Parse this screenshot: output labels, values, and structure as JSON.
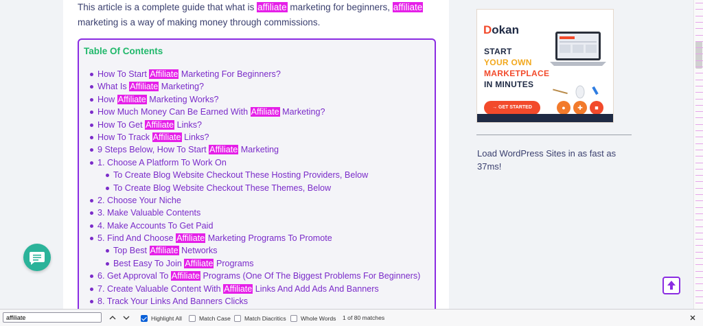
{
  "article": {
    "intro": [
      {
        "t": "This article is a complete guide that what is "
      },
      {
        "t": "affiliate",
        "hl": true
      },
      {
        "t": " marketing for beginners, "
      },
      {
        "t": "affiliate",
        "hl": true
      },
      {
        "t": " marketing is a way of making money through commissions."
      }
    ]
  },
  "toc": {
    "title": "Table Of Contents",
    "items": [
      {
        "level": 1,
        "parts": [
          {
            "t": "How To Start "
          },
          {
            "t": "Affiliate",
            "hl": true
          },
          {
            "t": " Marketing For Beginners?"
          }
        ]
      },
      {
        "level": 1,
        "parts": [
          {
            "t": "What Is "
          },
          {
            "t": "Affiliate",
            "hl": true
          },
          {
            "t": " Marketing?"
          }
        ]
      },
      {
        "level": 1,
        "parts": [
          {
            "t": "How "
          },
          {
            "t": "Affiliate",
            "hl": true
          },
          {
            "t": " Marketing Works?"
          }
        ]
      },
      {
        "level": 1,
        "parts": [
          {
            "t": "How Much Money Can Be Earned With "
          },
          {
            "t": "Affiliate",
            "hl": true
          },
          {
            "t": " Marketing?"
          }
        ]
      },
      {
        "level": 1,
        "parts": [
          {
            "t": "How To Get "
          },
          {
            "t": "Affiliate",
            "hl": true
          },
          {
            "t": " Links?"
          }
        ]
      },
      {
        "level": 1,
        "parts": [
          {
            "t": "How To Track "
          },
          {
            "t": "Affiliate",
            "hl": true
          },
          {
            "t": " Links?"
          }
        ]
      },
      {
        "level": 1,
        "parts": [
          {
            "t": "9 Steps Below, How To Start "
          },
          {
            "t": "Affiliate",
            "hl": true
          },
          {
            "t": " Marketing"
          }
        ]
      },
      {
        "level": 1,
        "parts": [
          {
            "t": "1. Choose A Platform To Work On"
          }
        ]
      },
      {
        "level": 2,
        "parts": [
          {
            "t": "To Create Blog Website Checkout These Hosting Providers, Below"
          }
        ]
      },
      {
        "level": 2,
        "parts": [
          {
            "t": "To Create Blog Website Checkout These Themes, Below"
          }
        ]
      },
      {
        "level": 1,
        "parts": [
          {
            "t": "2. Choose Your Niche"
          }
        ]
      },
      {
        "level": 1,
        "parts": [
          {
            "t": "3. Make Valuable Contents"
          }
        ]
      },
      {
        "level": 1,
        "parts": [
          {
            "t": "4. Make Accounts To Get Paid"
          }
        ]
      },
      {
        "level": 1,
        "parts": [
          {
            "t": "5. Find And Choose "
          },
          {
            "t": "Affiliate",
            "hl": true
          },
          {
            "t": " Marketing Programs To Promote"
          }
        ]
      },
      {
        "level": 2,
        "parts": [
          {
            "t": "Top Best "
          },
          {
            "t": "Affiliate",
            "hl": true
          },
          {
            "t": " Networks"
          }
        ]
      },
      {
        "level": 2,
        "parts": [
          {
            "t": "Best Easy To Join "
          },
          {
            "t": "Affiliate",
            "hl": true
          },
          {
            "t": " Programs"
          }
        ]
      },
      {
        "level": 1,
        "parts": [
          {
            "t": "6. Get Approval To "
          },
          {
            "t": "Affiliate",
            "hl": true
          },
          {
            "t": " Programs (One Of The Biggest Problems For Beginners)"
          }
        ]
      },
      {
        "level": 1,
        "parts": [
          {
            "t": "7. Create Valuable Content With "
          },
          {
            "t": "Affiliate",
            "hl": true
          },
          {
            "t": " Links And Add Ads And Banners"
          }
        ]
      },
      {
        "level": 1,
        "parts": [
          {
            "t": "8. Track Your Links And Banners Clicks"
          }
        ]
      }
    ]
  },
  "sidebar": {
    "ad": {
      "logo_first": "D",
      "logo_rest": "okan",
      "lines": [
        "START",
        "YOUR OWN",
        "MARKETPLACE",
        "IN MINUTES"
      ],
      "cta": "→ GET STARTED"
    },
    "text": "Load WordPress Sites in as fast as 37ms!"
  },
  "find_bar": {
    "query": "affiliate",
    "options": {
      "highlight_all": "Highlight All",
      "match_case": "Match Case",
      "match_diacritics": "Match Diacritics",
      "whole_words": "Whole Words"
    },
    "highlight_all_checked": true,
    "match_count": "1 of 80 matches"
  },
  "colors": {
    "highlight": "#e51fe8",
    "toc_border": "#8a2be2",
    "toc_title": "#21b86b",
    "link": "#7a2bc9",
    "chat": "#2bb39a",
    "brand_orange": "#f24a2b"
  },
  "icons": {
    "chat": "chat-bubble-icon",
    "back_to_top": "arrow-up-icon",
    "find_previous": "chevron-up-icon",
    "find_next": "chevron-down-icon",
    "close": "close-icon"
  }
}
